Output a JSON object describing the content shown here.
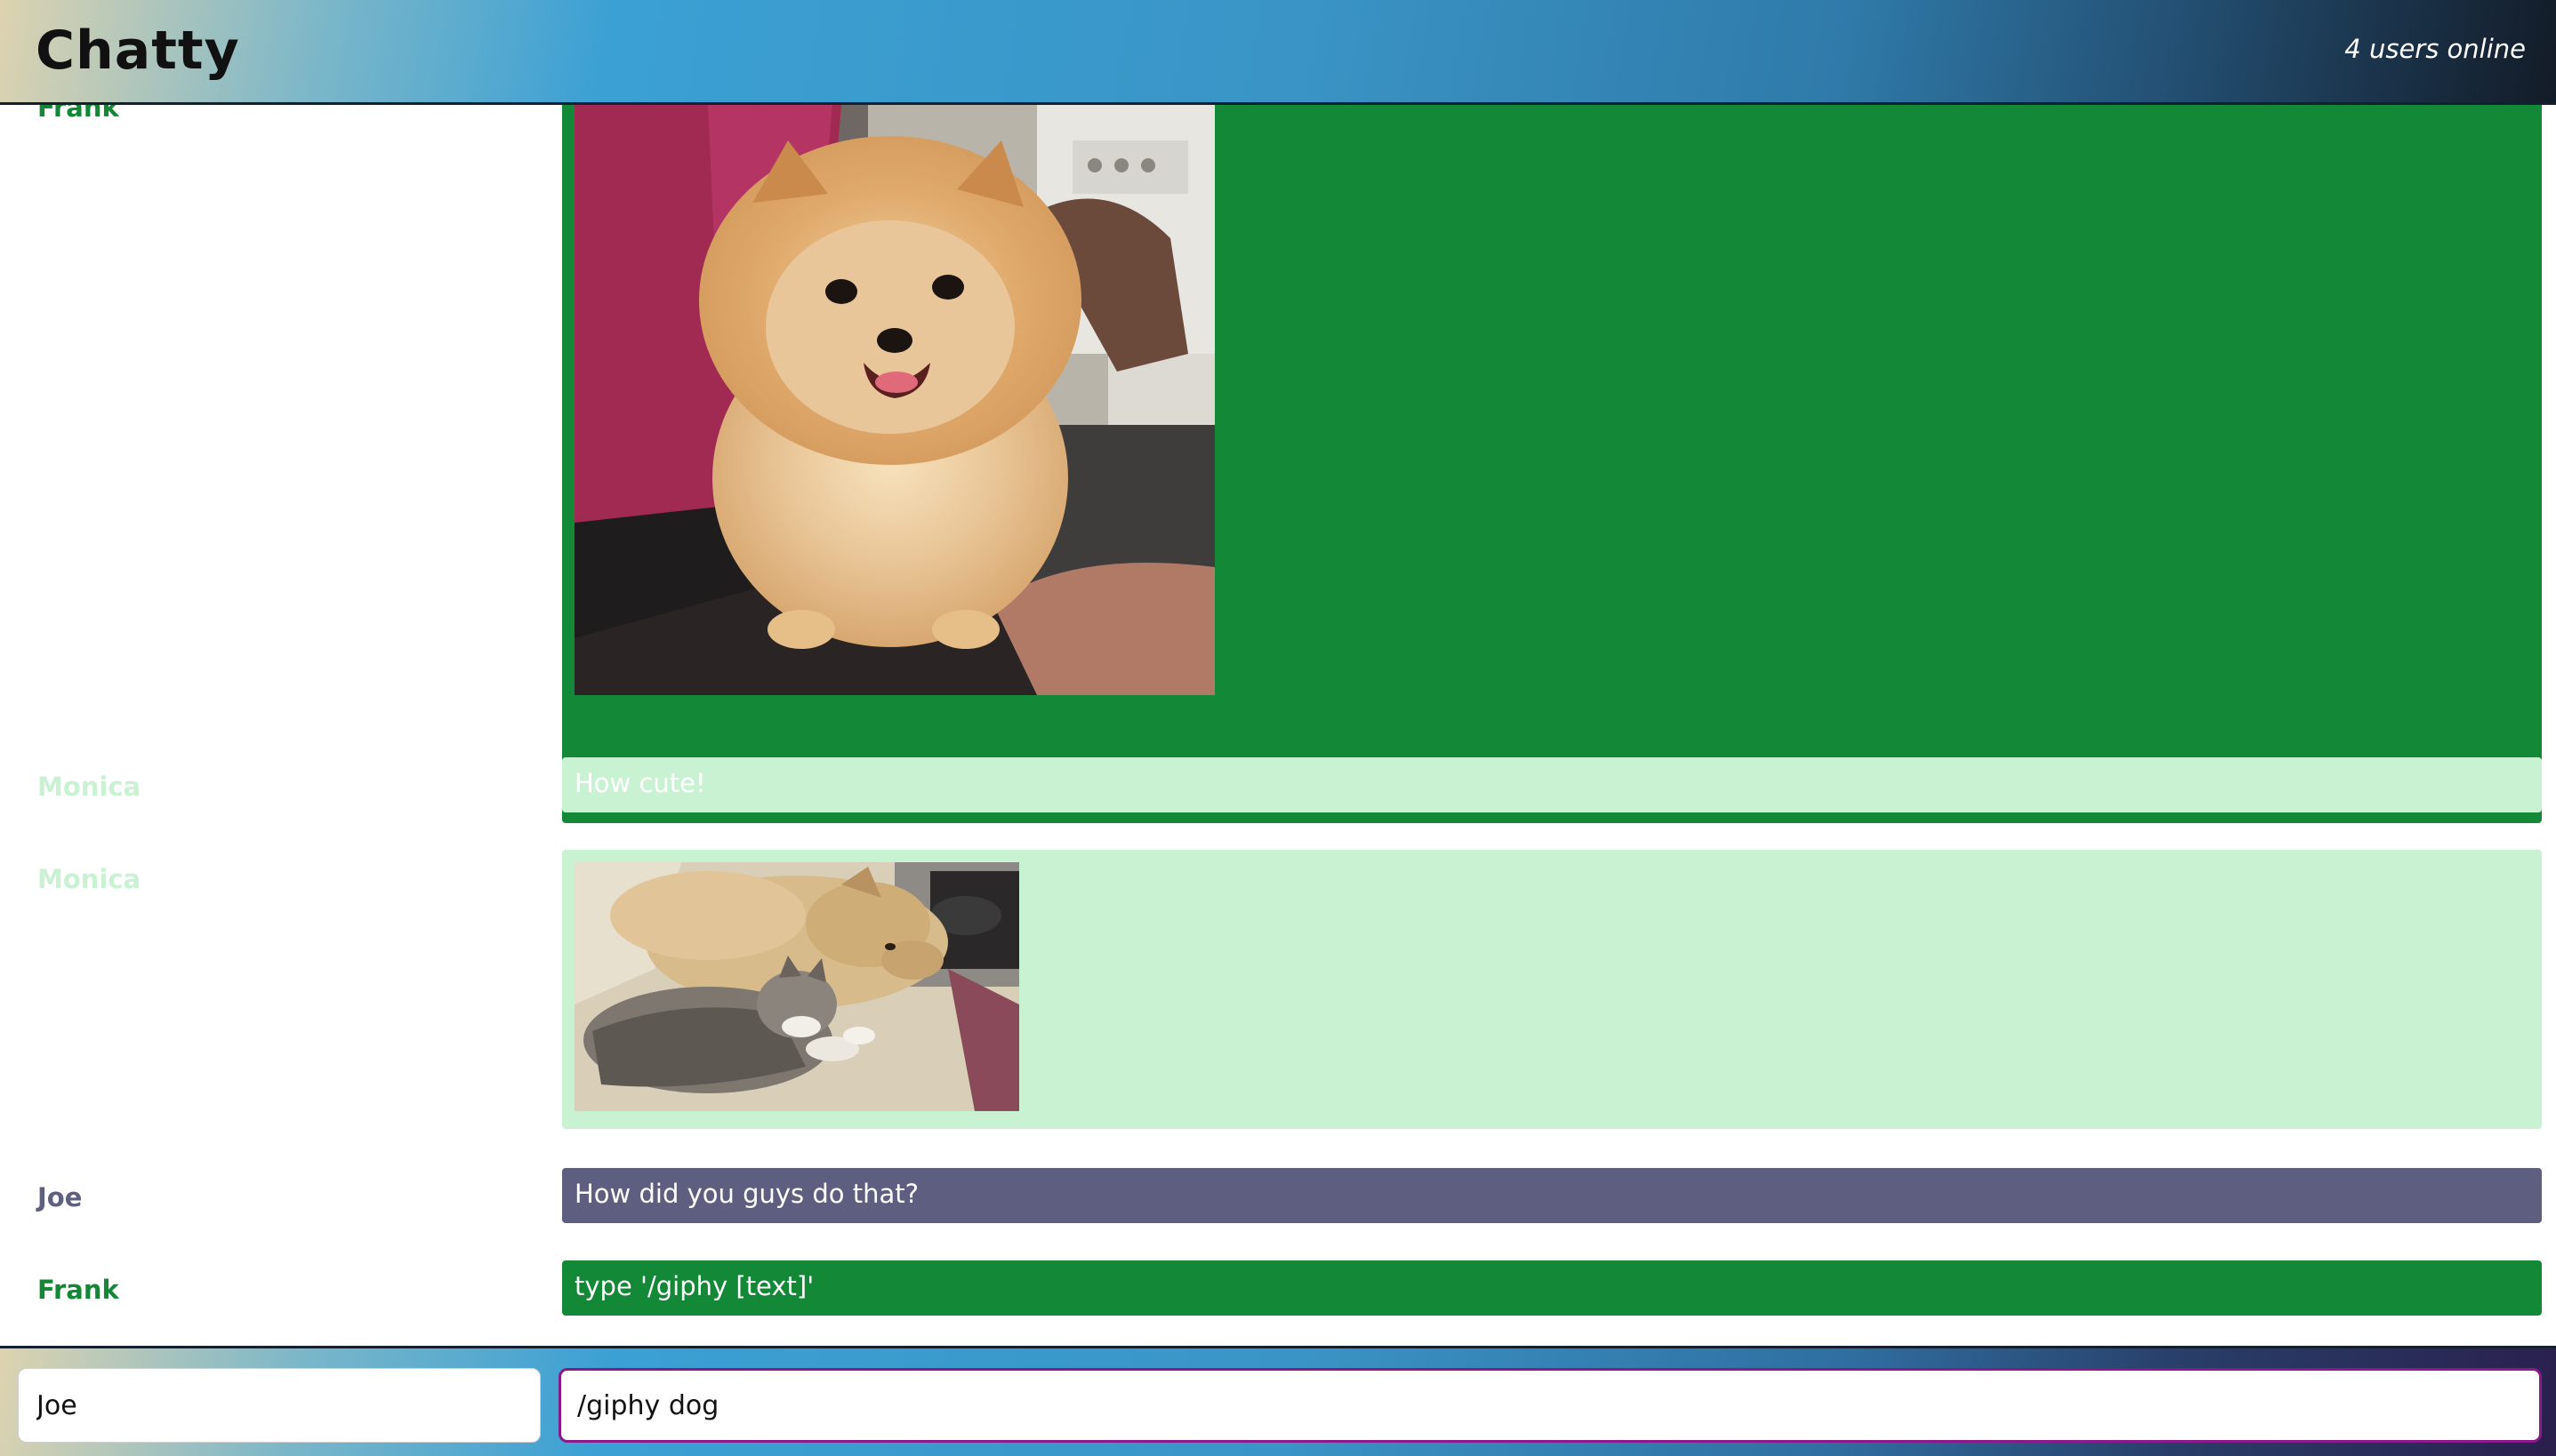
{
  "header": {
    "title": "Chatty",
    "users_online": "4 users online"
  },
  "messages": [
    {
      "username": "Frank",
      "type": "image",
      "image_alt": "pomeranian-gif",
      "colors": {
        "bubble": "#138837",
        "name": "#148737"
      }
    },
    {
      "username": "Monica",
      "type": "text",
      "text": "How cute!",
      "colors": {
        "bubble": "#c9f2d3",
        "name": "#c9f2d3"
      }
    },
    {
      "username": "Monica",
      "type": "image",
      "image_alt": "dog-and-cat-gif",
      "colors": {
        "bubble": "#c9f2d3",
        "name": "#c9f2d3"
      }
    },
    {
      "username": "Joe",
      "type": "text",
      "text": "How did you guys do that?",
      "colors": {
        "bubble": "#5e5f80",
        "name": "#5e6080"
      }
    },
    {
      "username": "Frank",
      "type": "text",
      "text": "type '/giphy [text]'",
      "colors": {
        "bubble": "#138837",
        "name": "#148737"
      }
    }
  ],
  "footer": {
    "name_value": "Joe",
    "message_value": "/giphy dog"
  }
}
